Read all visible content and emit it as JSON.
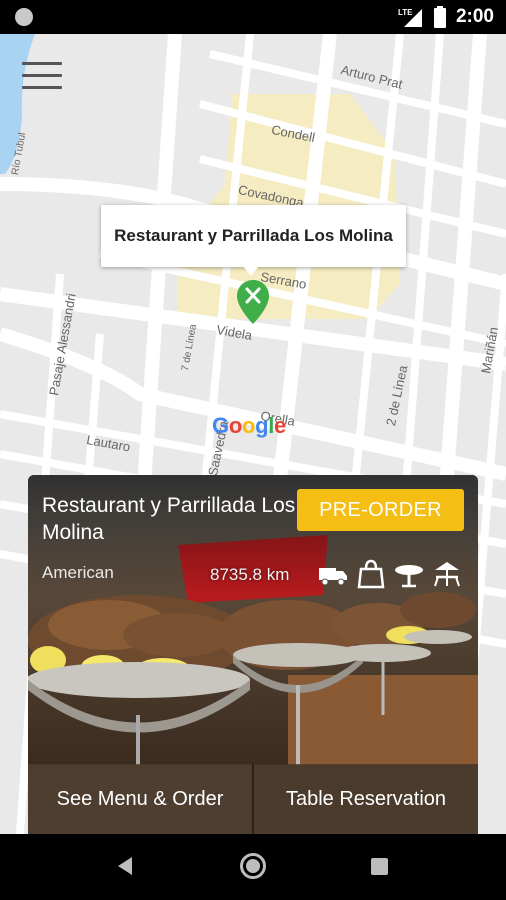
{
  "status_bar": {
    "time": "2:00",
    "network": "LTE"
  },
  "map": {
    "streets": {
      "arturo_prat": "Arturo Prat",
      "condell": "Condell",
      "covadonga": "Covadonga",
      "serrano": "Serrano",
      "videla": "Videla",
      "orella": "Orella",
      "lautaro": "Lautaro",
      "saavedra": "Saavedra",
      "pasaje_alessandri": "Pasaje Alessandri",
      "siete_de_linea": "7 de Línea",
      "dos_de_linea": "2 de Línea",
      "marinan": "Mariñán",
      "rio_tubul": "Río Tubul"
    },
    "callout_title": "Restaurant y Parrillada Los Molina",
    "logo_text": "Google"
  },
  "card": {
    "name": "Restaurant y Parrillada Los Molina",
    "preorder_label": "PRE-ORDER",
    "cuisine": "American",
    "distance": "8735.8 km",
    "amenities": [
      "delivery-truck-icon",
      "takeaway-bag-icon",
      "dine-in-table-icon",
      "outdoor-seating-icon"
    ],
    "see_menu_label": "See Menu & Order",
    "reservation_label": "Table Reservation"
  },
  "colors": {
    "accent": "#f5be14",
    "map_bg": "#e9e9e9",
    "pin": "#3fae49"
  }
}
